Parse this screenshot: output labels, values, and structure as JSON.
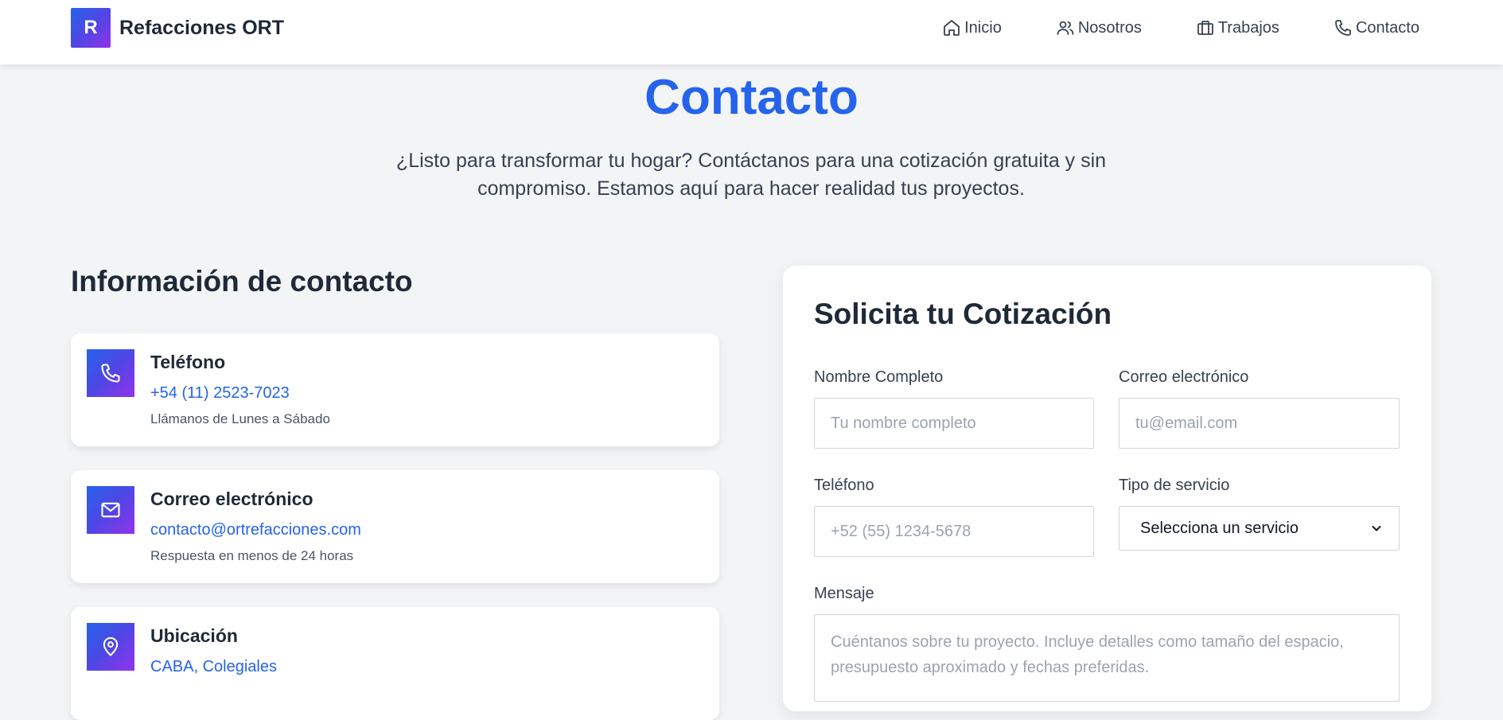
{
  "header": {
    "logo_letter": "R",
    "brand": "Refacciones ORT",
    "nav": [
      {
        "label": "Inicio",
        "icon": "home-icon"
      },
      {
        "label": "Nosotros",
        "icon": "users-icon"
      },
      {
        "label": "Trabajos",
        "icon": "briefcase-icon"
      },
      {
        "label": "Contacto",
        "icon": "phone-icon"
      }
    ]
  },
  "hero": {
    "title": "Contacto",
    "subtitle": "¿Listo para transformar tu hogar? Contáctanos para una cotización gratuita y sin compromiso. Estamos aquí para hacer realidad tus proyectos."
  },
  "info": {
    "title": "Información de contacto",
    "cards": [
      {
        "icon": "phone-icon",
        "title": "Teléfono",
        "value": "+54 (11) 2523-7023",
        "note": "Llámanos de Lunes a Sábado"
      },
      {
        "icon": "mail-icon",
        "title": "Correo electrónico",
        "value": "contacto@ortrefacciones.com",
        "note": "Respuesta en menos de 24 horas"
      },
      {
        "icon": "map-pin-icon",
        "title": "Ubicación",
        "value": "CABA, Colegiales",
        "note": ""
      }
    ]
  },
  "form": {
    "title": "Solicita tu Cotización",
    "name": {
      "label": "Nombre Completo",
      "placeholder": "Tu nombre completo"
    },
    "email": {
      "label": "Correo electrónico",
      "placeholder": "tu@email.com"
    },
    "phone": {
      "label": "Teléfono",
      "placeholder": "+52 (55) 1234-5678"
    },
    "service": {
      "label": "Tipo de servicio",
      "selected": "Selecciona un servicio"
    },
    "message": {
      "label": "Mensaje",
      "placeholder": "Cuéntanos sobre tu proyecto. Incluye detalles como tamaño del espacio, presupuesto aproximado y fechas preferidas."
    }
  },
  "colors": {
    "accent": "#2563eb",
    "gradient_start": "#2563eb",
    "gradient_end": "#9333ea",
    "background": "#f3f4f6"
  }
}
